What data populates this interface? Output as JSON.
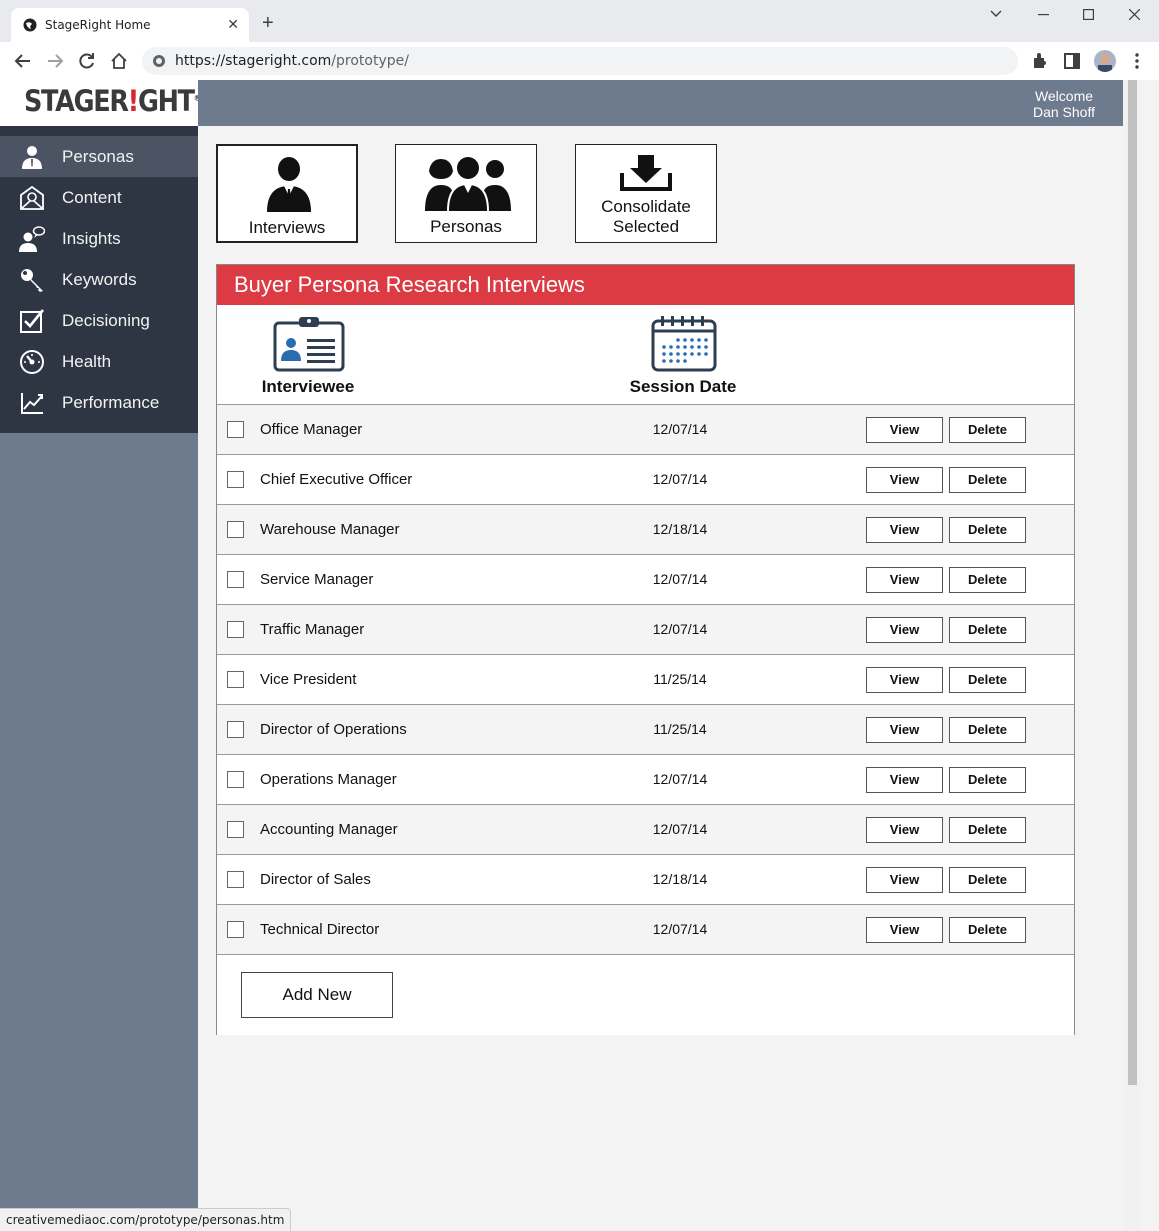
{
  "browser": {
    "tab_title": "StageRight Home",
    "url_domain": "https://stageright.com",
    "url_path": "/prototype/",
    "status_url": "creativemediaoc.com/prototype/personas.htm"
  },
  "header": {
    "logo_text_a": "STAGER",
    "logo_text_b": "!",
    "logo_text_c": "GHT",
    "logo_mark": "®",
    "welcome_line1": "Welcome",
    "welcome_line2": "Dan Shoff"
  },
  "sidebar": {
    "items": [
      {
        "label": "Personas",
        "icon": "person-icon",
        "active": true
      },
      {
        "label": "Content",
        "icon": "email-icon",
        "active": false
      },
      {
        "label": "Insights",
        "icon": "speech-person-icon",
        "active": false
      },
      {
        "label": "Keywords",
        "icon": "key-icon",
        "active": false
      },
      {
        "label": "Decisioning",
        "icon": "checkbox-icon",
        "active": false
      },
      {
        "label": "Health",
        "icon": "gauge-icon",
        "active": false
      },
      {
        "label": "Performance",
        "icon": "line-chart-icon",
        "active": false
      }
    ]
  },
  "actions": {
    "interviews": "Interviews",
    "personas": "Personas",
    "consolidate_line1": "Consolidate",
    "consolidate_line2": "Selected"
  },
  "panel": {
    "title": "Buyer Persona Research Interviews",
    "col_interviewee": "Interviewee",
    "col_session_date": "Session Date",
    "view_label": "View",
    "delete_label": "Delete",
    "add_new_label": "Add New",
    "rows": [
      {
        "name": "Office Manager",
        "date": "12/07/14"
      },
      {
        "name": "Chief Executive Officer",
        "date": "12/07/14"
      },
      {
        "name": "Warehouse Manager",
        "date": "12/18/14"
      },
      {
        "name": "Service Manager",
        "date": "12/07/14"
      },
      {
        "name": "Traffic Manager",
        "date": "12/07/14"
      },
      {
        "name": "Vice President",
        "date": "11/25/14"
      },
      {
        "name": "Director of Operations",
        "date": "11/25/14"
      },
      {
        "name": "Operations Manager",
        "date": "12/07/14"
      },
      {
        "name": "Accounting Manager",
        "date": "12/07/14"
      },
      {
        "name": "Director of Sales",
        "date": "12/18/14"
      },
      {
        "name": "Technical Director",
        "date": "12/07/14"
      }
    ]
  },
  "colors": {
    "accent_red": "#dc3b43",
    "sidebar_dark": "#2f3643",
    "sidebar_active": "#4c5463",
    "slate": "#6e7a8e"
  }
}
